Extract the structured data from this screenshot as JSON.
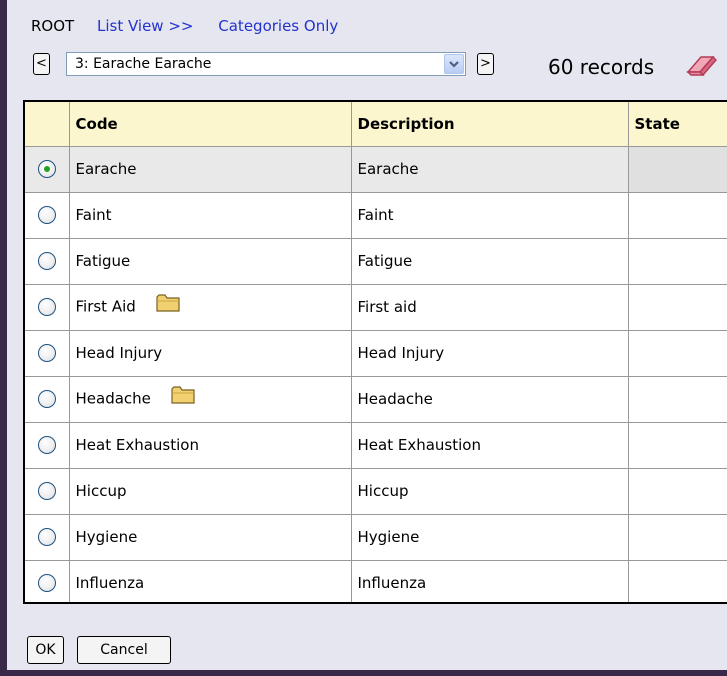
{
  "toolbar": {
    "root_label": "ROOT",
    "list_view_link": "List View >>",
    "categories_link": "Categories Only"
  },
  "nav": {
    "prev_label": "<",
    "next_label": ">",
    "selected_value": "3: Earache Earache",
    "record_count": "60 records"
  },
  "table": {
    "headers": {
      "code": "Code",
      "description": "Description",
      "state": "State"
    },
    "rows": [
      {
        "code": "Earache",
        "description": "Earache",
        "state": "",
        "selected": true,
        "folder": false
      },
      {
        "code": "Faint",
        "description": "Faint",
        "state": "",
        "selected": false,
        "folder": false
      },
      {
        "code": "Fatigue",
        "description": "Fatigue",
        "state": "",
        "selected": false,
        "folder": false
      },
      {
        "code": "First Aid",
        "description": "First aid",
        "state": "",
        "selected": false,
        "folder": true
      },
      {
        "code": "Head Injury",
        "description": "Head Injury",
        "state": "",
        "selected": false,
        "folder": false
      },
      {
        "code": "Headache",
        "description": "Headache",
        "state": "",
        "selected": false,
        "folder": true
      },
      {
        "code": "Heat Exhaustion",
        "description": "Heat Exhaustion",
        "state": "",
        "selected": false,
        "folder": false
      },
      {
        "code": "Hiccup",
        "description": "Hiccup",
        "state": "",
        "selected": false,
        "folder": false
      },
      {
        "code": "Hygiene",
        "description": "Hygiene",
        "state": "",
        "selected": false,
        "folder": false
      },
      {
        "code": "Influenza",
        "description": "Influenza",
        "state": "",
        "selected": false,
        "folder": false
      }
    ]
  },
  "footer": {
    "ok_label": "OK",
    "cancel_label": "Cancel"
  },
  "icons": {
    "clear": "eraser-icon",
    "dropdown": "chevron-down-icon",
    "category": "folder-icon"
  },
  "colors": {
    "link": "#2233cc",
    "header_bg": "#fcf6cf",
    "selected_row_bg": "#e9e9e9",
    "radio_checked": "#21a121"
  }
}
